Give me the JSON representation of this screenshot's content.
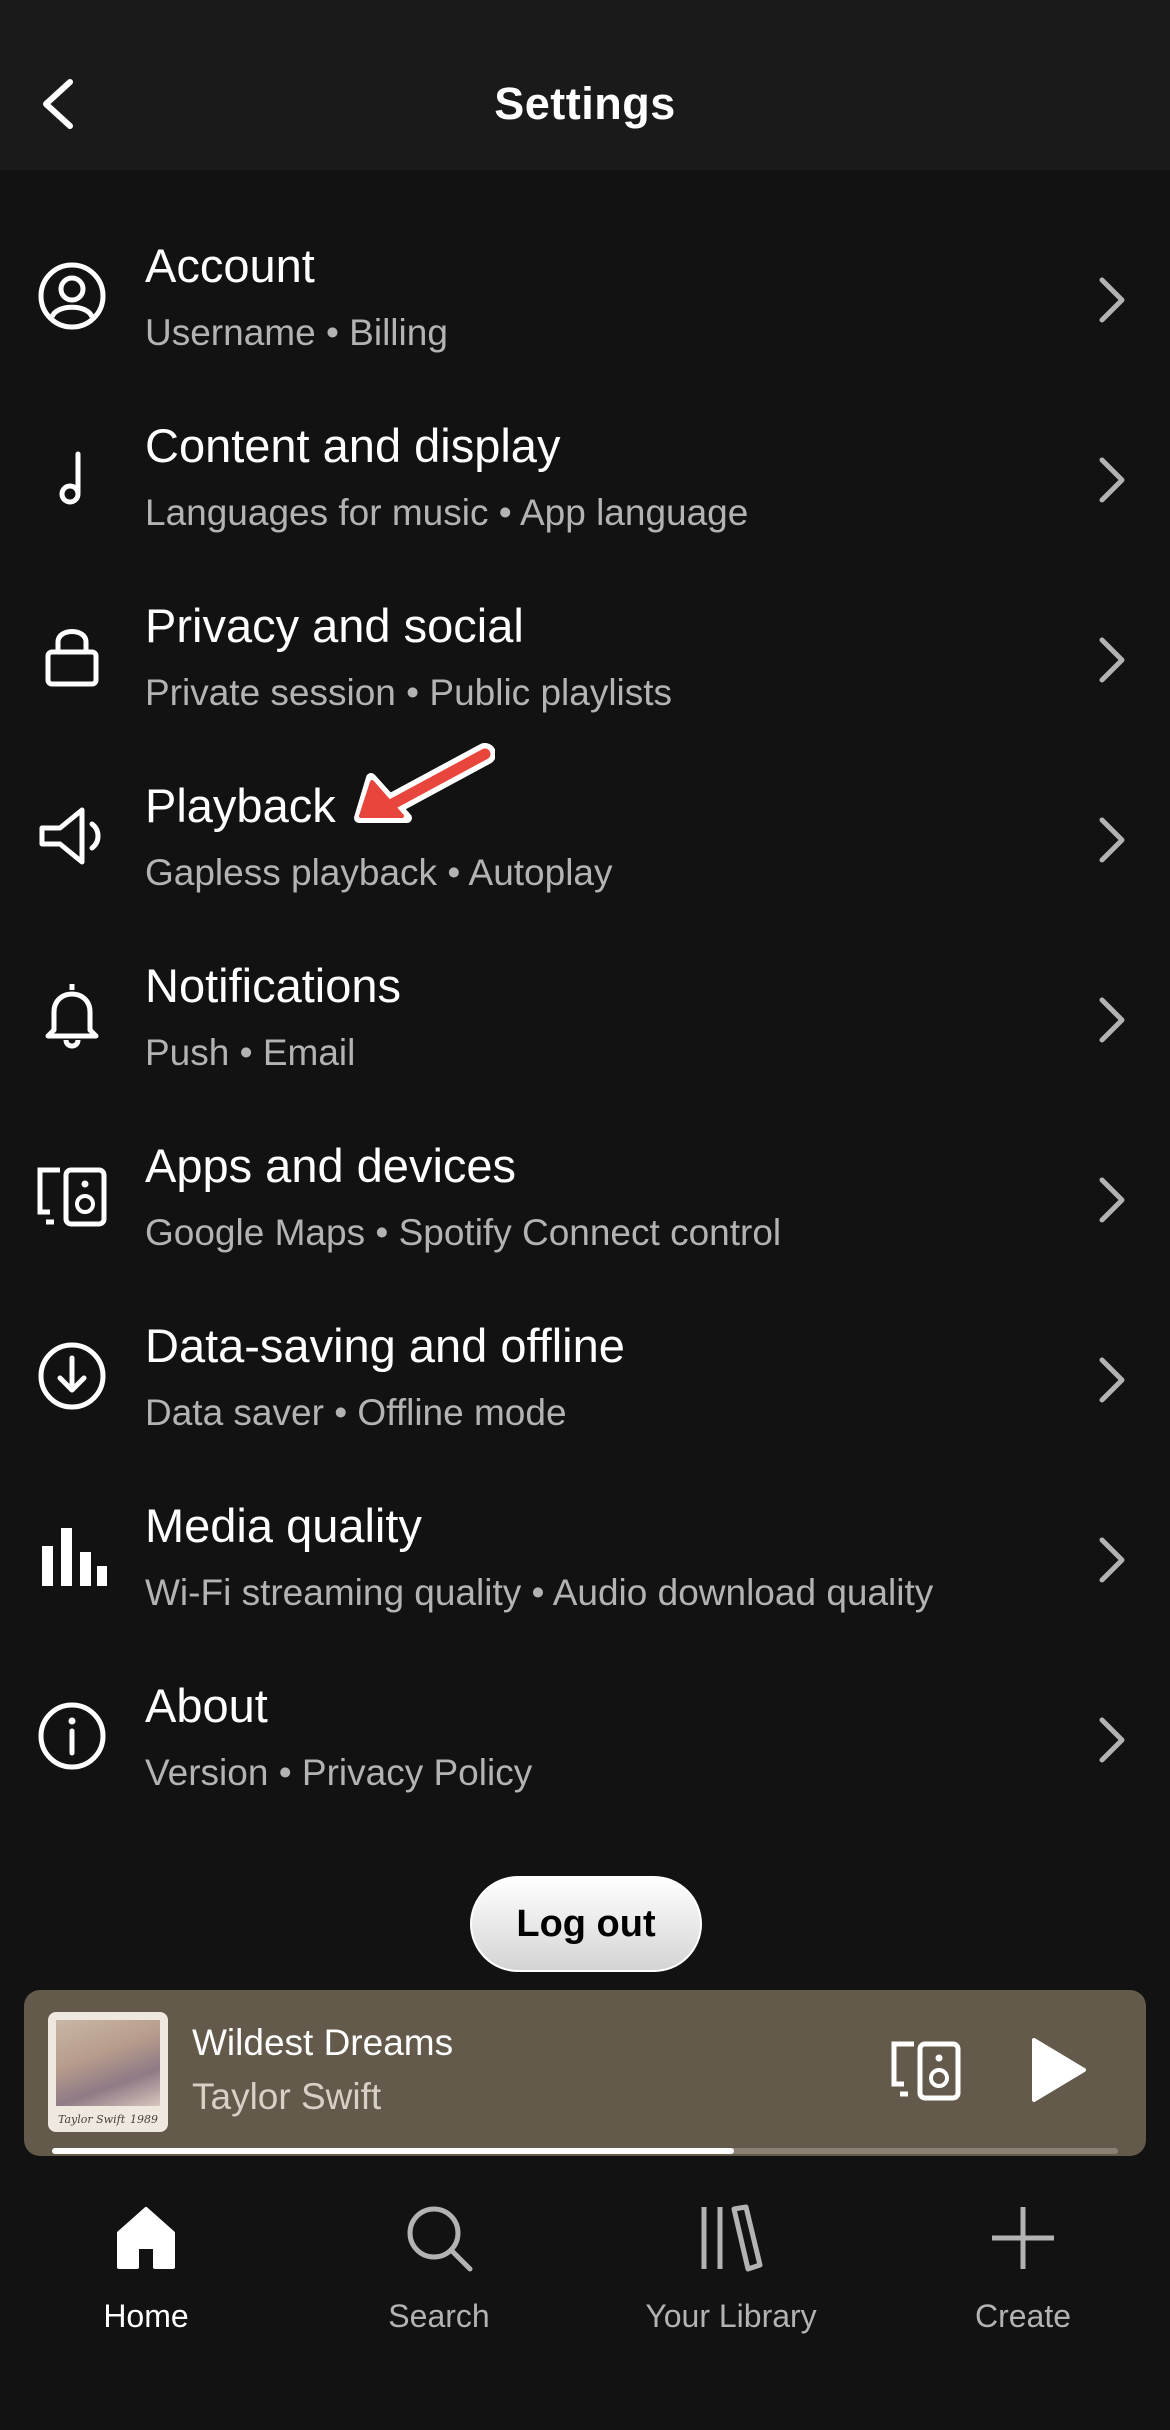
{
  "header": {
    "title": "Settings",
    "back_icon": "chevron-left-icon"
  },
  "settings": [
    {
      "title": "Account",
      "subtitle": "Username • Billing",
      "icon": "account-icon"
    },
    {
      "title": "Content and display",
      "subtitle": "Languages for music • App language",
      "icon": "music-note-icon"
    },
    {
      "title": "Privacy and social",
      "subtitle": "Private session • Public playlists",
      "icon": "lock-icon"
    },
    {
      "title": "Playback",
      "subtitle": "Gapless playback • Autoplay",
      "icon": "speaker-icon"
    },
    {
      "title": "Notifications",
      "subtitle": "Push • Email",
      "icon": "bell-icon"
    },
    {
      "title": "Apps and devices",
      "subtitle": "Google Maps • Spotify Connect control",
      "icon": "devices-icon"
    },
    {
      "title": "Data-saving and offline",
      "subtitle": "Data saver • Offline mode",
      "icon": "download-icon"
    },
    {
      "title": "Media quality",
      "subtitle": "Wi-Fi streaming quality • Audio download quality",
      "icon": "bar-chart-icon"
    },
    {
      "title": "About",
      "subtitle": "Version • Privacy Policy",
      "icon": "info-icon"
    }
  ],
  "logout": {
    "label": "Log out"
  },
  "now_playing": {
    "track": "Wildest Dreams",
    "artist": "Taylor Swift",
    "album_caption": "Taylor Swift",
    "album_year": "1989",
    "progress": 0.64
  },
  "nav": [
    {
      "label": "Home",
      "icon": "home-icon",
      "active": true
    },
    {
      "label": "Search",
      "icon": "search-icon",
      "active": false
    },
    {
      "label": "Your Library",
      "icon": "library-icon",
      "active": false
    },
    {
      "label": "Create",
      "icon": "plus-icon",
      "active": false
    }
  ],
  "colors": {
    "background": "#121212",
    "header": "#1a1a1a",
    "subtitle": "#b3b3b3",
    "mini_player": "#645a4b",
    "annotation": "#e8453c"
  }
}
